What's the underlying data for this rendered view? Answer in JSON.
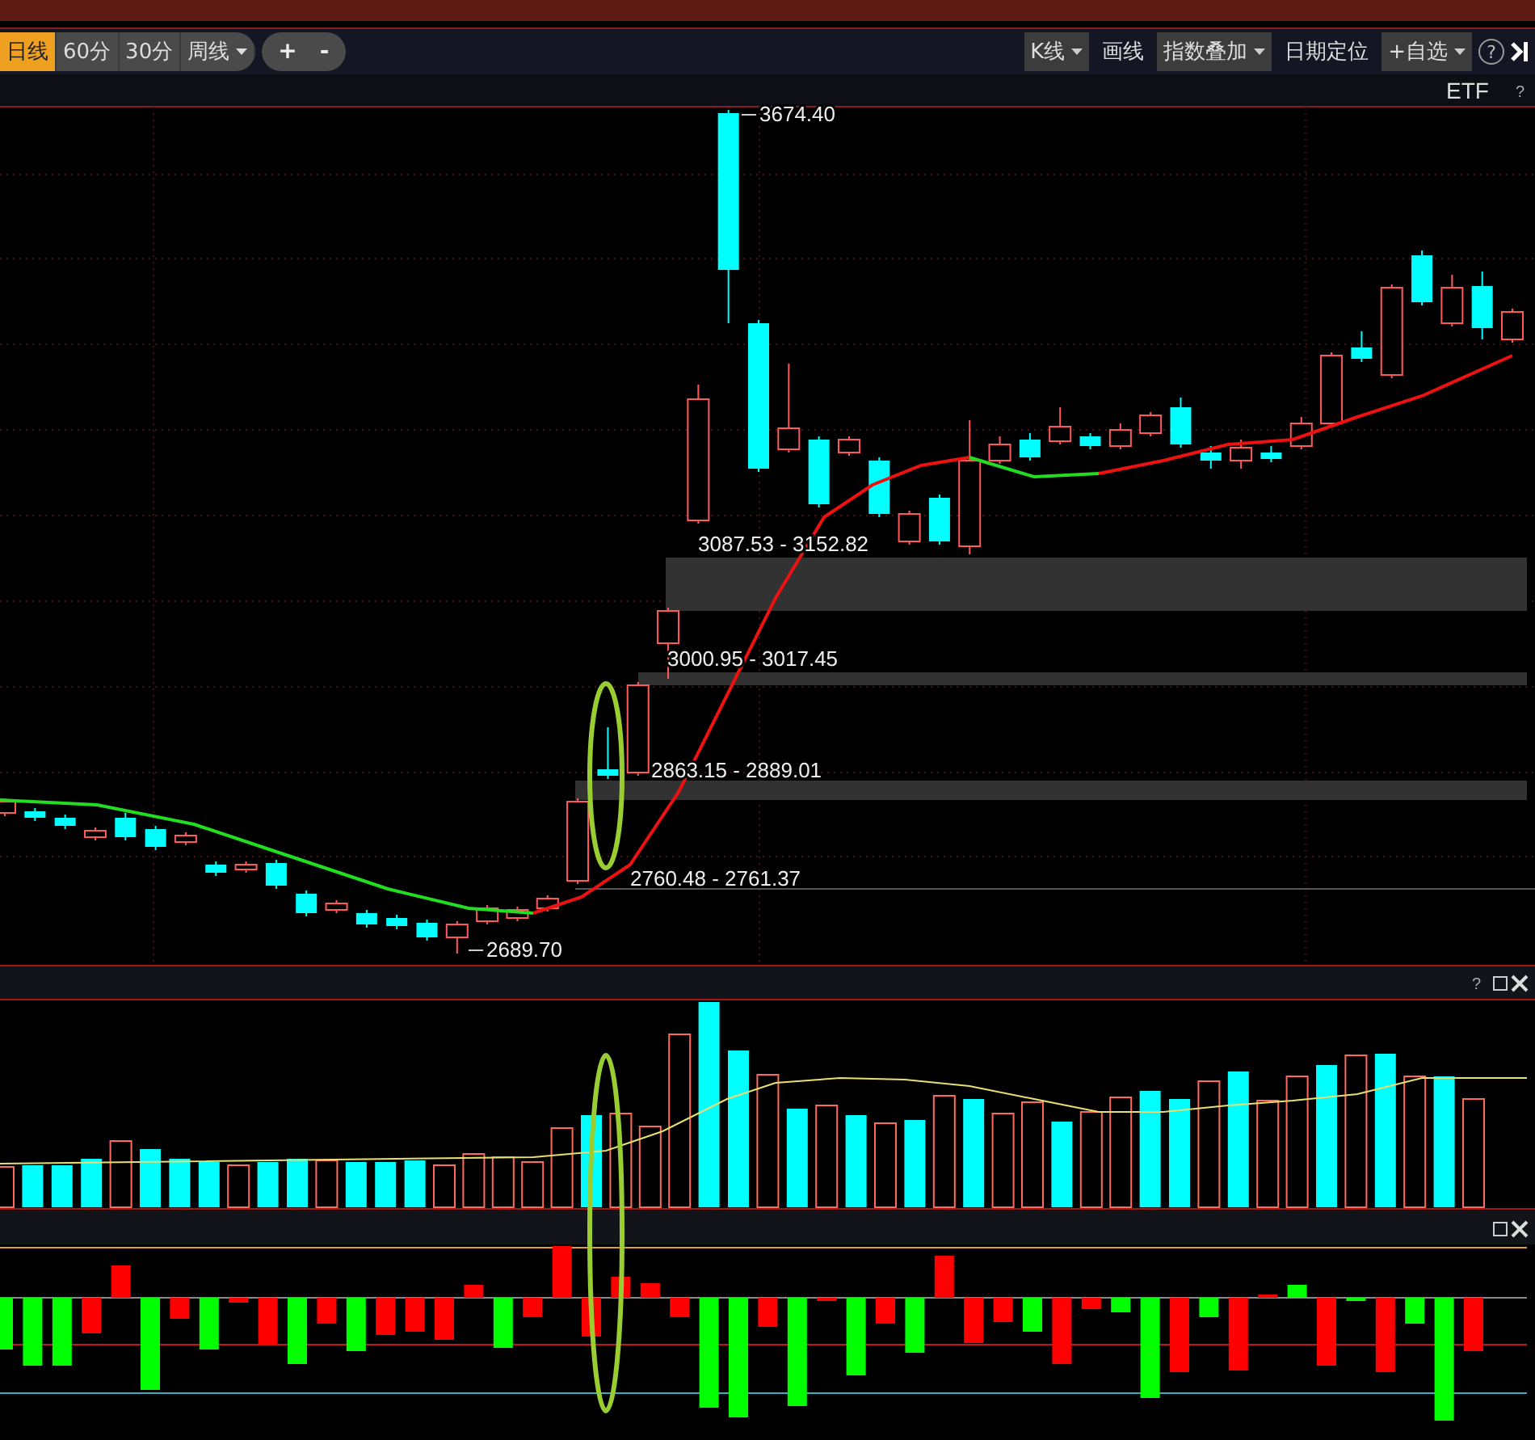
{
  "toolbar": {
    "periods": [
      {
        "label": "日线",
        "selected": true,
        "kind": "plain"
      },
      {
        "label": "60分",
        "selected": false,
        "kind": "plain"
      },
      {
        "label": "30分",
        "selected": false,
        "kind": "plain"
      },
      {
        "label": "周线",
        "selected": false,
        "kind": "dropdown"
      }
    ],
    "zoom": [
      "+",
      "-"
    ],
    "tools": [
      {
        "label": "K线",
        "kind": "dropdown"
      },
      {
        "label": "画线",
        "kind": "plain"
      },
      {
        "label": "指数叠加",
        "kind": "dropdown"
      },
      {
        "label": "日期定位",
        "kind": "plain"
      },
      {
        "label": "+自选",
        "kind": "dropdown"
      }
    ],
    "help": "?"
  },
  "chart": {
    "symbol": "ETF",
    "help": "?",
    "price_labels": [
      "3674.40",
      "3087.53 - 3152.82",
      "3000.95 - 3017.45",
      "2863.15 - 2889.01",
      "2760.48 - 2761.37",
      "2689.70"
    ]
  },
  "volume_panel": {
    "help": "?"
  }
}
